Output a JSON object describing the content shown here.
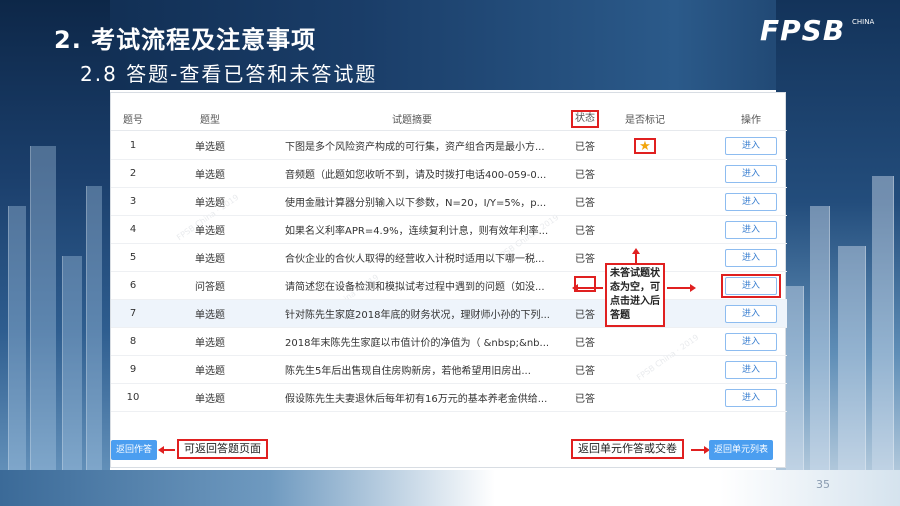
{
  "slide": {
    "title": "2. 考试流程及注意事项",
    "subtitle": "2.8  答题-查看已答和未答试题",
    "logo": "FPSB",
    "logo_sub": "CHINA",
    "page_number": "35"
  },
  "table": {
    "headers": {
      "num": "题号",
      "type": "题型",
      "summary": "试题摘要",
      "status": "状态",
      "marked": "是否标记",
      "action": "操作"
    },
    "rows": [
      {
        "num": "1",
        "type": "单选题",
        "summary": "下图是多个风险资产构成的可行集，资产组合丙是最小方...",
        "status": "已答",
        "marked": true
      },
      {
        "num": "2",
        "type": "单选题",
        "summary": "音频题（此题如您收听不到，请及时拨打电话400-059-0...",
        "status": "已答",
        "marked": false
      },
      {
        "num": "3",
        "type": "单选题",
        "summary": "使用金融计算器分别输入以下参数，N=20，I/Y=5%，p...",
        "status": "已答",
        "marked": false
      },
      {
        "num": "4",
        "type": "单选题",
        "summary": "如果名义利率APR=4.9%，连续复利计息，则有效年利率...",
        "status": "已答",
        "marked": false
      },
      {
        "num": "5",
        "type": "单选题",
        "summary": "合伙企业的合伙人取得的经营收入计税时适用以下哪一税...",
        "status": "已答",
        "marked": false
      },
      {
        "num": "6",
        "type": "问答题",
        "summary": "请简述您在设备检测和模拟试考过程中遇到的问题（如没...",
        "status": "",
        "marked": false
      },
      {
        "num": "7",
        "type": "单选题",
        "summary": "针对陈先生家庭2018年底的财务状况，理财师小孙的下列...",
        "status": "已答",
        "marked": false
      },
      {
        "num": "8",
        "type": "单选题",
        "summary": "2018年末陈先生家庭以市值计价的净值为（ &nbsp;&nb...",
        "status": "已答",
        "marked": false
      },
      {
        "num": "9",
        "type": "单选题",
        "summary": "陈先生5年后出售现自住房购新房，若他希望用旧房出...",
        "status": "已答",
        "marked": false
      },
      {
        "num": "10",
        "type": "单选题",
        "summary": "假设陈先生夫妻退休后每年初有16万元的基本养老金供给...",
        "status": "已答",
        "marked": false
      }
    ],
    "enter_label": "进入",
    "star_glyph": "★",
    "star_color": "#f2a60c"
  },
  "callout": {
    "text": "未答试题状态为空，可点击进入后答题"
  },
  "footer": {
    "back_button": "返回作答",
    "back_note": "可返回答题页面",
    "unit_note": "返回单元作答或交卷",
    "unit_button": "返回单元列表"
  },
  "colors": {
    "accent_red": "#e02020",
    "button_blue": "#4b9ef0",
    "link_blue": "#3a7fd0"
  }
}
